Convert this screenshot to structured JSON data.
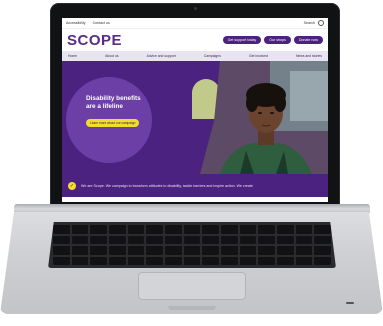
{
  "site": {
    "utility_links": [
      "Accessibility",
      "Contact us"
    ],
    "search_label": "Search",
    "logo": "SCOPE",
    "header_buttons": [
      "Get support today",
      "Our shops",
      "Donate now"
    ],
    "nav_items": [
      "Home",
      "About us",
      "Advice and support",
      "Campaigns",
      "Get involved",
      "News and stories"
    ],
    "hero": {
      "title": "Disability benefits are a lifeline",
      "cta": "Learn more about our campaign"
    },
    "strip_text": "We are Scope. We campaign to transform attitudes to disability, tackle barriers and inspire action. We create"
  },
  "colors": {
    "brand_purple": "#4b2280",
    "accent_yellow": "#f2de2a",
    "nav_bg": "#e9e4f1"
  }
}
